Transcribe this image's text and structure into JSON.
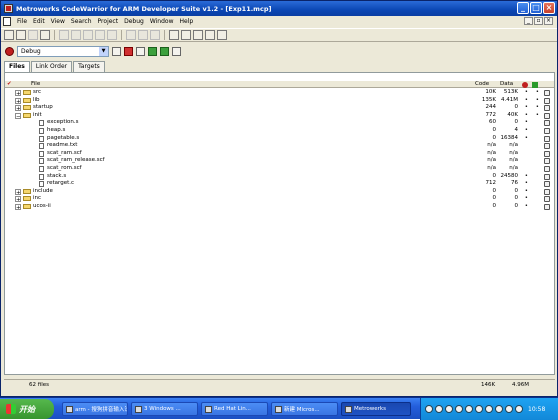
{
  "window": {
    "title": "Metrowerks CodeWarrior for ARM Developer Suite v1.2 - [Exp11.mcp]",
    "min_glyph": "_",
    "max_glyph": "□",
    "close_glyph": "×"
  },
  "menubar": {
    "items": [
      "File",
      "Edit",
      "View",
      "Search",
      "Project",
      "Debug",
      "Window",
      "Help"
    ],
    "mdi": [
      "_",
      "▫",
      "×"
    ]
  },
  "project_toolbar": {
    "target": "Debug",
    "arrow": "▼"
  },
  "tabs": [
    "Files",
    "Link Order",
    "Targets"
  ],
  "list": {
    "header": {
      "check": "✔",
      "file": "File",
      "code": "Code",
      "data": "Data"
    },
    "rows": [
      {
        "type": "folder",
        "level": 0,
        "expander": "+",
        "name": "src",
        "code": "10K",
        "data": "513K",
        "dot": "•",
        "mark": "•"
      },
      {
        "type": "folder",
        "level": 0,
        "expander": "+",
        "name": "lib",
        "code": "135K",
        "data": "4.41M",
        "dot": "•",
        "mark": "•"
      },
      {
        "type": "folder",
        "level": 0,
        "expander": "+",
        "name": "startup",
        "code": "244",
        "data": "0",
        "dot": "•",
        "mark": "•"
      },
      {
        "type": "folder",
        "level": 0,
        "expander": "−",
        "name": "init",
        "code": "772",
        "data": "40K",
        "dot": "•",
        "mark": "•"
      },
      {
        "type": "file",
        "level": 1,
        "name": "exception.s",
        "code": "60",
        "data": "0",
        "dot": "•",
        "mark": ""
      },
      {
        "type": "file",
        "level": 1,
        "name": "heap.s",
        "code": "0",
        "data": "4",
        "dot": "•",
        "mark": ""
      },
      {
        "type": "file",
        "level": 1,
        "name": "pagetable.s",
        "code": "0",
        "data": "16384",
        "dot": "•",
        "mark": ""
      },
      {
        "type": "file",
        "level": 1,
        "name": "readme.txt",
        "code": "n/a",
        "data": "n/a",
        "dot": "",
        "mark": ""
      },
      {
        "type": "file",
        "level": 1,
        "name": "scat_ram.scf",
        "code": "n/a",
        "data": "n/a",
        "dot": "",
        "mark": ""
      },
      {
        "type": "file",
        "level": 1,
        "name": "scat_ram_release.scf",
        "code": "n/a",
        "data": "n/a",
        "dot": "",
        "mark": ""
      },
      {
        "type": "file",
        "level": 1,
        "name": "scat_rom.scf",
        "code": "n/a",
        "data": "n/a",
        "dot": "",
        "mark": ""
      },
      {
        "type": "file",
        "level": 1,
        "name": "stack.s",
        "code": "0",
        "data": "24580",
        "dot": "•",
        "mark": ""
      },
      {
        "type": "file",
        "level": 1,
        "name": "retarget.c",
        "code": "712",
        "data": "76",
        "dot": "•",
        "mark": ""
      },
      {
        "type": "folder",
        "level": 0,
        "expander": "+",
        "name": "include",
        "code": "0",
        "data": "0",
        "dot": "•",
        "mark": ""
      },
      {
        "type": "folder",
        "level": 0,
        "expander": "+",
        "name": "inc",
        "code": "0",
        "data": "0",
        "dot": "•",
        "mark": ""
      },
      {
        "type": "folder",
        "level": 0,
        "expander": "+",
        "name": "ucos-ii",
        "code": "0",
        "data": "0",
        "dot": "•",
        "mark": ""
      }
    ]
  },
  "status": {
    "files": "62 files",
    "code": "146K",
    "data": "4.96M"
  },
  "taskbar": {
    "start": "开始",
    "buttons": [
      {
        "label": "arm - 搜狗拼音输入法"
      },
      {
        "label": "3 Windows ..."
      },
      {
        "label": "Red Hat Lin..."
      },
      {
        "label": "新建 Micros..."
      },
      {
        "label": "Metrowerks"
      }
    ],
    "clock": "10:58"
  },
  "colors": {
    "title_bar": "#0b47b4",
    "taskbar": "#245edb",
    "start_button": "#37952f",
    "tray": "#1288d8"
  }
}
